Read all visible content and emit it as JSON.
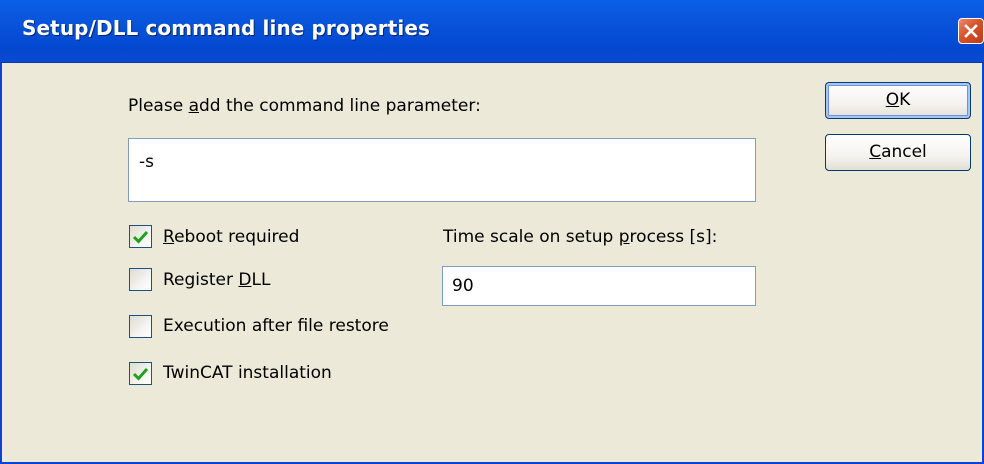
{
  "dialog": {
    "title": "Setup/DLL command line properties",
    "close_icon": "close-icon"
  },
  "param": {
    "label_pre": "Please ",
    "label_accel": "a",
    "label_post": "dd the command line parameter:",
    "value": "-s"
  },
  "checkboxes": [
    {
      "accel": "R",
      "rest": "eboot required",
      "pre": "",
      "checked": true
    },
    {
      "pre": "Register ",
      "accel": "D",
      "rest": "LL",
      "checked": false
    },
    {
      "pre": "Execution after file restore",
      "accel": "",
      "rest": "",
      "checked": false
    },
    {
      "pre": "TwinCAT installation",
      "accel": "",
      "rest": "",
      "checked": true
    }
  ],
  "timescale": {
    "label_pre": "Time scale on setup ",
    "label_accel": "p",
    "label_post": "rocess [s]:",
    "value": "90"
  },
  "buttons": {
    "ok_accel": "O",
    "ok_rest": "K",
    "cancel_accel": "C",
    "cancel_rest": "ancel"
  },
  "colors": {
    "titlebar": "#0650d8",
    "dialog_bg": "#ece9d8",
    "field_border": "#7f9db9",
    "check_mark": "#21a121"
  }
}
